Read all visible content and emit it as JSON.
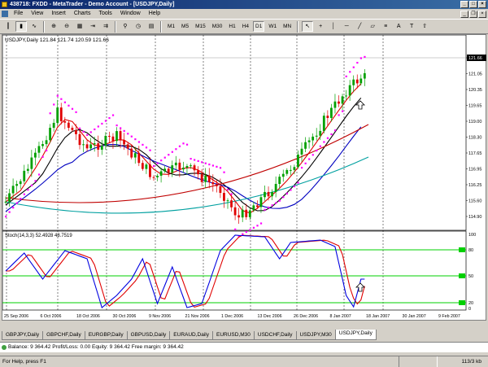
{
  "window": {
    "title": "438718: FXDD - MetaTrader - Demo Account - [USDJPY,Daily]"
  },
  "menu": {
    "items": [
      "File",
      "View",
      "Insert",
      "Charts",
      "Tools",
      "Window",
      "Help"
    ]
  },
  "toolbar": {
    "timeframes": [
      "M1",
      "M5",
      "M15",
      "M30",
      "H1",
      "H4",
      "D1",
      "W1",
      "MN"
    ],
    "active_timeframe": "D1"
  },
  "chart": {
    "header": "USDJPY,Daily  121.84 121.74 120.59 121.66",
    "stoch_header": "Stoch(14,3,3) 52.4928 48.7519",
    "price_labels": [
      "121.66",
      "121.05",
      "120.35",
      "119.65",
      "119.00",
      "118.30",
      "117.65",
      "116.95",
      "116.25",
      "115.60",
      "114.90"
    ],
    "current_price": "121.66",
    "stoch_labels": [
      "100",
      "80",
      "50",
      "20",
      "0"
    ],
    "date_labels": [
      "25 Sep 2006",
      "6 Oct 2006",
      "18 Oct 2006",
      "30 Oct 2006",
      "9 Nov 2006",
      "21 Nov 2006",
      "1 Dec 2006",
      "13 Dec 2006",
      "26 Dec 2006",
      "8 Jan 2007",
      "18 Jan 2007",
      "30 Jan 2007",
      "9 Feb 2007"
    ]
  },
  "tabs": {
    "items": [
      "GBPJPY,Daily",
      "GBPCHF,Daily",
      "EURGBP,Daily",
      "GBPUSD,Daily",
      "EURAUD,Daily",
      "EURUSD,M30",
      "USDCHF,Daily",
      "USDJPY,M30",
      "USDJPY,Daily"
    ],
    "active": "USDJPY,Daily"
  },
  "balance": {
    "text": "Balance: 9 364.42  Profit/Loss: 0.00  Equity: 9 364.42  Free margin: 9 364.42"
  },
  "status": {
    "help": "For Help, press F1",
    "traffic": "113/3 kb"
  },
  "colors": {
    "bull": "#00a000",
    "bear": "#e00000",
    "sar": "#ff00ff",
    "ma_black": "#000000",
    "ma_red": "#e00000",
    "ma_blue": "#0000c0",
    "ma_darkred": "#c00000",
    "ma_teal": "#00a0a0",
    "stoch_main": "#0000e0",
    "stoch_signal": "#e00000",
    "stoch_level": "#00d000"
  }
}
